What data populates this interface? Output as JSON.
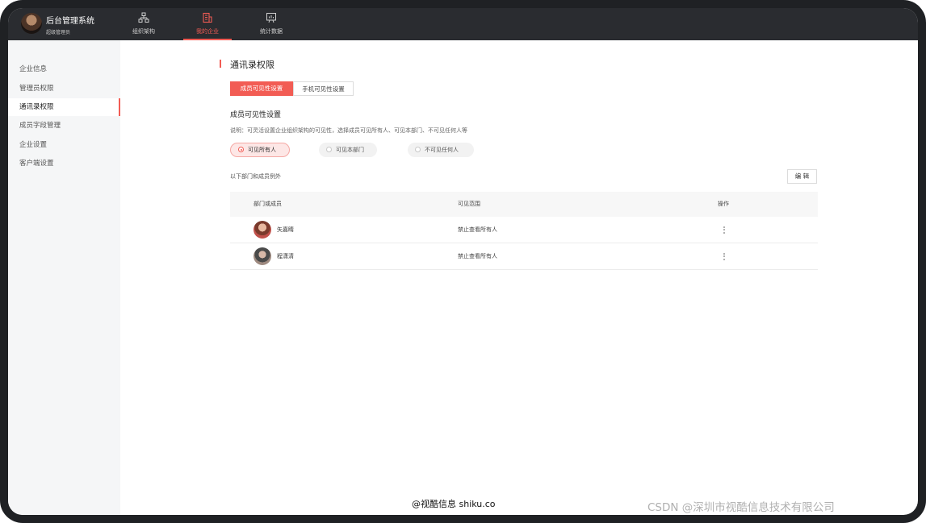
{
  "header": {
    "app_title": "后台管理系统",
    "user_role": "超级管理员",
    "nav": [
      {
        "label": "组织架构",
        "icon": "org-structure-icon"
      },
      {
        "label": "我的企业",
        "icon": "enterprise-icon",
        "active": true
      },
      {
        "label": "统计数据",
        "icon": "statistics-icon"
      }
    ]
  },
  "sidebar": {
    "items": [
      {
        "label": "企业信息"
      },
      {
        "label": "管理员权限"
      },
      {
        "label": "通讯录权限",
        "active": true
      },
      {
        "label": "成员字段管理"
      },
      {
        "label": "企业设置"
      },
      {
        "label": "客户端设置"
      }
    ]
  },
  "main": {
    "title": "通讯录权限",
    "tabs": [
      {
        "label": "成员可见性设置",
        "active": true
      },
      {
        "label": "手机可见性设置"
      }
    ],
    "section_heading": "成员可见性设置",
    "description": "说明：可灵活设置企业组织架构的可见性，选择成员可见所有人、可见本部门、不可见任何人等",
    "visibility_options": [
      {
        "label": "可见所有人",
        "selected": true
      },
      {
        "label": "可见本部门"
      },
      {
        "label": "不可见任何人"
      }
    ],
    "exceptions_label": "以下部门和成员例外",
    "edit_button": "编 辑",
    "table": {
      "headers": [
        "部门或成员",
        "可见范围",
        "操作"
      ],
      "rows": [
        {
          "name": "矢嘉睛",
          "scope": "禁止查看所有人"
        },
        {
          "name": "程潇清",
          "scope": "禁止查看所有人"
        }
      ]
    }
  },
  "watermarks": {
    "center": "@视酷信息 shiku.co",
    "right": "CSDN @深圳市视酷信息技术有限公司"
  },
  "colors": {
    "accent": "#f25c54",
    "topbar": "#2a2c30",
    "sidebar": "#f5f6f7"
  }
}
